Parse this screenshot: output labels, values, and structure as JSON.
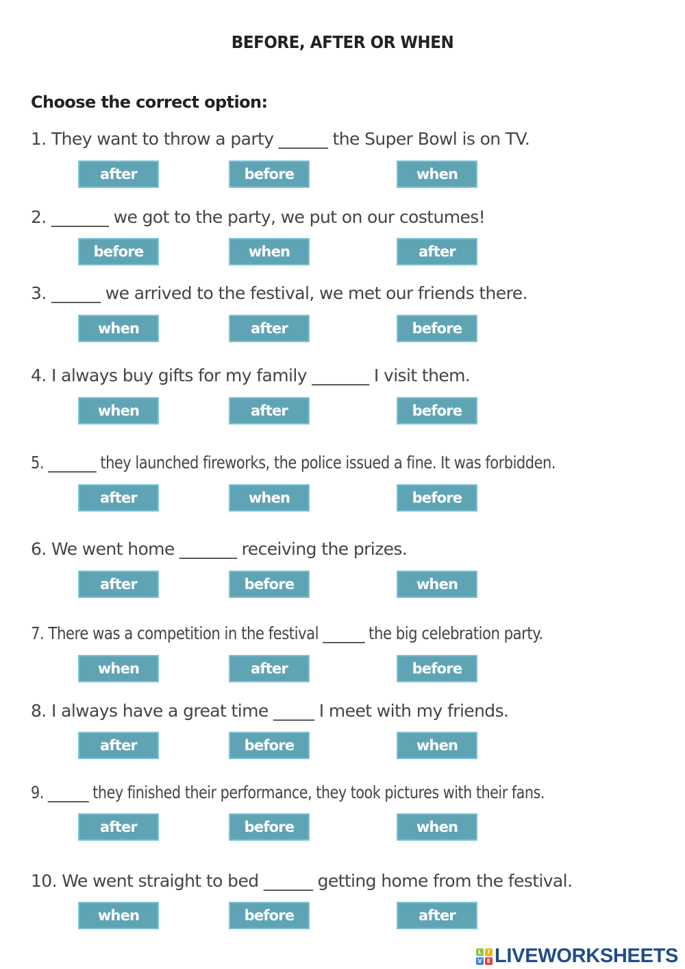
{
  "title": "BEFORE, AFTER OR WHEN",
  "instructions": "Choose the correct option:",
  "questions": [
    {
      "text": "1. They want to throw a party ______ the Super Bowl is on TV.",
      "options": [
        "after",
        "before",
        "when"
      ]
    },
    {
      "text": "2. _______ we got to the party, we put on our costumes!",
      "options": [
        "before",
        "when",
        "after"
      ]
    },
    {
      "text": "3. ______ we arrived to the festival, we met our friends there.",
      "options": [
        "when",
        "after",
        "before"
      ]
    },
    {
      "text": "4. I always buy gifts for my family _______ I visit them.",
      "options": [
        "when",
        "after",
        "before"
      ]
    },
    {
      "text": "5. _______ they launched fireworks, the police issued a fine. It was forbidden.",
      "options": [
        "after",
        "when",
        "before"
      ]
    },
    {
      "text": "6. We went home _______ receiving the prizes.",
      "options": [
        "after",
        "before",
        "when"
      ]
    },
    {
      "text": "7.  There was a competition in the festival ______ the big celebration party.",
      "options": [
        "when",
        "after",
        "before"
      ]
    },
    {
      "text": "8. I always have a great time _____ I meet with my friends.",
      "options": [
        "after",
        "before",
        "when"
      ]
    },
    {
      "text": "9. ______ they finished their performance, they took pictures with their fans.",
      "options": [
        "after",
        "before",
        "when"
      ]
    },
    {
      "text": "10. We went straight to bed ______ getting home from the festival.",
      "options": [
        "when",
        "before",
        "after"
      ]
    }
  ],
  "logo": {
    "text": "LIVEWORKSHEETS",
    "icon_letters": [
      "L",
      "I",
      "V",
      "E"
    ],
    "icon_colors": [
      "#8bc34a",
      "#f5b400",
      "#3b82d6",
      "#e53935"
    ],
    "text_color": "#1f4c8a"
  },
  "colors": {
    "option_bg": "#5fa4b5",
    "option_border": "#7cc3d6",
    "option_text": "#ffffff"
  }
}
